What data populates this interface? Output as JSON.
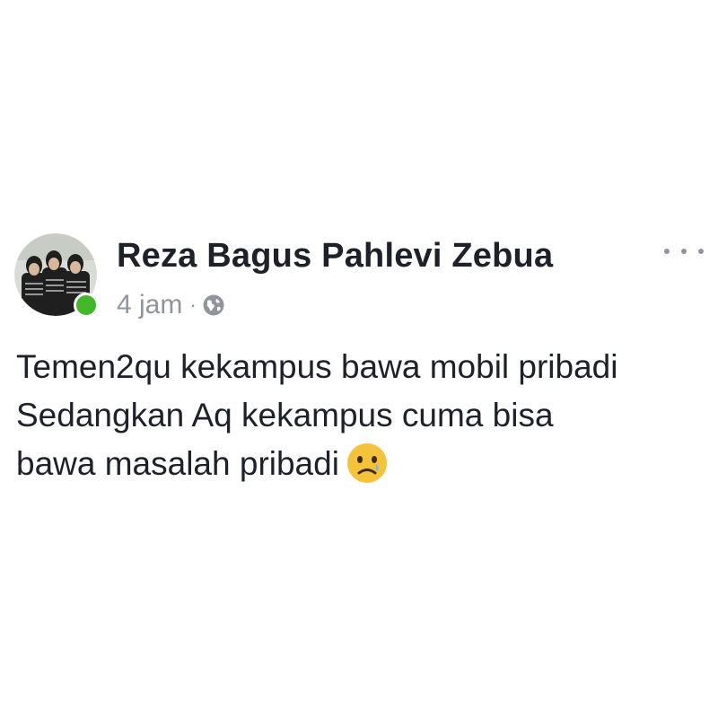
{
  "post": {
    "author_name": "Reza Bagus Pahlevi Zebua",
    "timestamp": "4 jam",
    "separator": "·",
    "audience_icon": "globe-icon",
    "online_status_color": "#42b72a",
    "more_icon": "more-horizontal-icon",
    "body_lines": [
      "Temen2qu kekampus bawa mobil pribadi",
      "Sedangkan Aq kekampus cuma bisa",
      "bawa masalah pribadi"
    ],
    "emoji": "crying-face-emoji"
  }
}
